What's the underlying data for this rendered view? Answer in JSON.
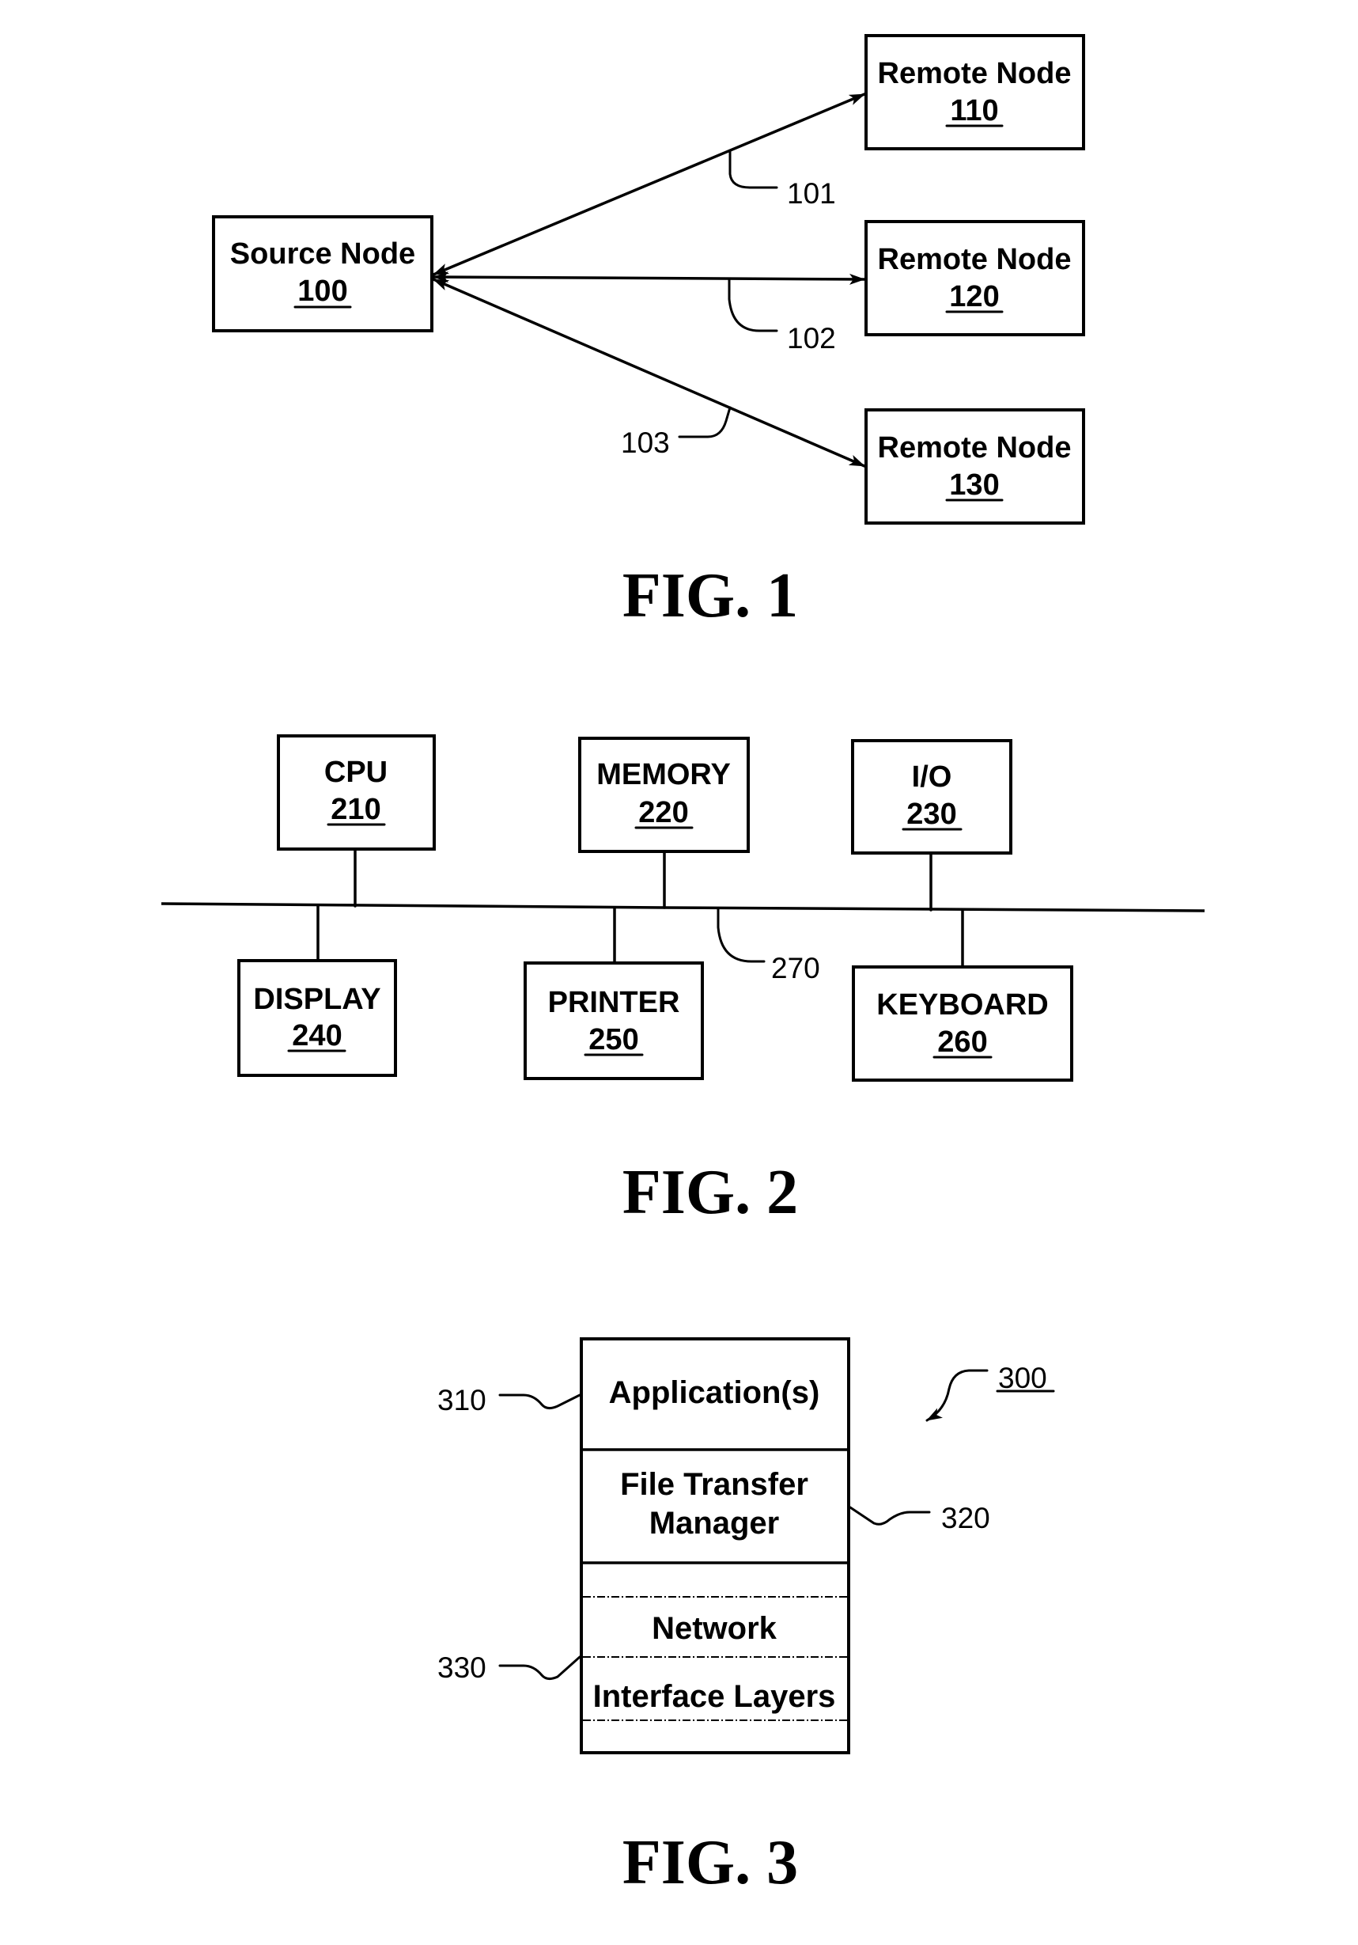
{
  "figures": {
    "fig1": {
      "caption": "FIG. 1",
      "source_node": {
        "label": "Source Node",
        "ref": "100"
      },
      "remote_nodes": [
        {
          "label": "Remote Node",
          "ref": "110"
        },
        {
          "label": "Remote Node",
          "ref": "120"
        },
        {
          "label": "Remote Node",
          "ref": "130"
        }
      ],
      "connections": [
        {
          "ref": "101",
          "from": "100",
          "to": "110",
          "bidirectional": true
        },
        {
          "ref": "102",
          "from": "100",
          "to": "120",
          "bidirectional": true
        },
        {
          "ref": "103",
          "from": "100",
          "to": "130",
          "bidirectional": true
        }
      ]
    },
    "fig2": {
      "caption": "FIG. 2",
      "bus_ref": "270",
      "top_components": [
        {
          "label": "CPU",
          "ref": "210"
        },
        {
          "label": "MEMORY",
          "ref": "220"
        },
        {
          "label": "I/O",
          "ref": "230"
        }
      ],
      "bottom_components": [
        {
          "label": "DISPLAY",
          "ref": "240"
        },
        {
          "label": "PRINTER",
          "ref": "250"
        },
        {
          "label": "KEYBOARD",
          "ref": "260"
        }
      ]
    },
    "fig3": {
      "caption": "FIG. 3",
      "stack_ref": "300",
      "layers": [
        {
          "lines": [
            "Application(s)"
          ],
          "ref": "310"
        },
        {
          "lines": [
            "File Transfer",
            "Manager"
          ],
          "ref": "320"
        },
        {
          "lines": [
            "Network",
            "Interface Layers"
          ],
          "ref": "330"
        }
      ]
    }
  },
  "colors": {
    "ink": "#000000",
    "paper": "#ffffff"
  }
}
